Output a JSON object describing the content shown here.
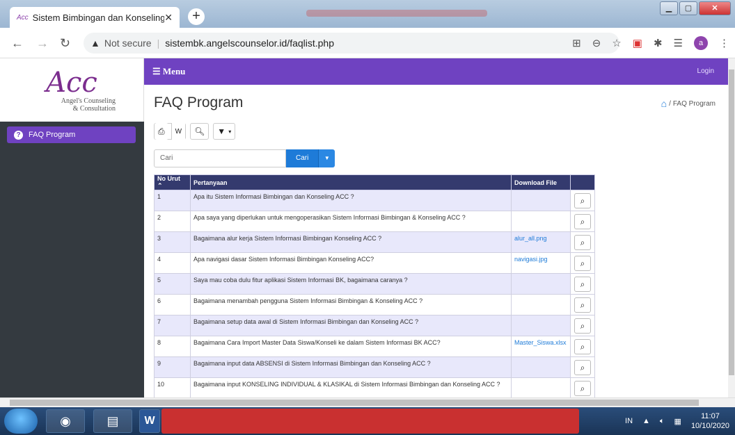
{
  "browser": {
    "tab_title": "Sistem Bimbingan dan Konseling",
    "tab_favicon": "Acc",
    "security_label": "Not secure",
    "url": "sistembk.angelscounselor.id/faqlist.php",
    "avatar_letter": "a"
  },
  "logo": {
    "main": "Acc",
    "line1": "Angel's Counseling",
    "line2": "& Consultation"
  },
  "sidebar": {
    "items": [
      {
        "label": "FAQ Program"
      }
    ]
  },
  "topnav": {
    "menu_label": "☰ Menu",
    "login_label": "Login"
  },
  "page": {
    "title": "FAQ Program",
    "breadcrumb_sep": "/",
    "breadcrumb_current": "FAQ Program"
  },
  "search": {
    "placeholder": "Cari",
    "button_label": "Cari"
  },
  "table": {
    "headers": [
      "No Urut",
      "Pertanyaan",
      "Download File",
      ""
    ],
    "rows": [
      {
        "no": "1",
        "q": "Apa itu Sistem Informasi Bimbingan dan Konseling ACC ?",
        "file": ""
      },
      {
        "no": "2",
        "q": "Apa saya yang diperlukan untuk mengoperasikan Sistem Informasi Bimbingan & Konseling ACC ?",
        "file": ""
      },
      {
        "no": "3",
        "q": "Bagaimana alur kerja Sistem Informasi Bimbingan Konseling ACC ?",
        "file": "alur_all.png"
      },
      {
        "no": "4",
        "q": "Apa navigasi dasar Sistem Informasi Bimbingan Konseling ACC?",
        "file": "navigasi.jpg"
      },
      {
        "no": "5",
        "q": "Saya mau coba dulu fitur aplikasi Sistem Informasi BK, bagaimana caranya ?",
        "file": ""
      },
      {
        "no": "6",
        "q": "Bagaimana menambah pengguna Sistem Informasi Bimbingan & Konseling ACC ?",
        "file": ""
      },
      {
        "no": "7",
        "q": "Bagaimana setup data awal di Sistem Informasi Bimbingan dan Konseling ACC ?",
        "file": ""
      },
      {
        "no": "8",
        "q": "Bagaimana Cara Import Master Data Siswa/Konseli ke dalam Sistem Informasi BK ACC?",
        "file": "Master_Siswa.xlsx"
      },
      {
        "no": "9",
        "q": "Bagaimana input data ABSENSI di Sistem Informasi Bimbingan dan Konseling ACC ?",
        "file": ""
      },
      {
        "no": "10",
        "q": "Bagaimana input KONSELING INDIVIDUAL & KLASIKAL di Sistem Informasi Bimbingan dan Konseling ACC ?",
        "file": ""
      }
    ]
  },
  "taskbar": {
    "lang": "IN",
    "time": "11:07",
    "date": "10/10/2020"
  },
  "colors": {
    "accent": "#6f42c1",
    "header_bg": "#343a6e",
    "sidebar_bg": "#343a40",
    "link": "#1e7bd8"
  }
}
